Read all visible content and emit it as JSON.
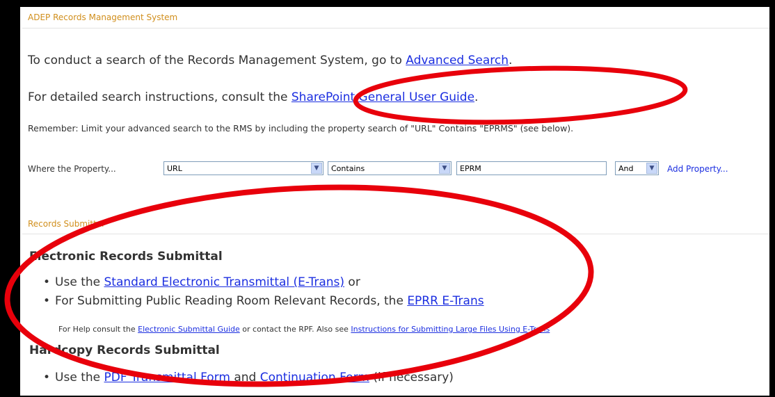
{
  "rms_section": {
    "title": "ADEP Records Management System"
  },
  "intro": {
    "line1_prefix": "To conduct a search of the Records Management System, go to ",
    "line1_link": "Advanced Search",
    "line1_suffix": ".",
    "line2_prefix": "For detailed search instructions, consult the ",
    "line2_link": "SharePoint General User Guide",
    "line2_suffix": ".",
    "reminder": "Remember: Limit your advanced search to the RMS by including the property search of \"URL\" Contains \"EPRMS\" (see below)."
  },
  "property_row": {
    "label": "Where the Property...",
    "property_value": "URL",
    "operator_value": "Contains",
    "text_value": "EPRM",
    "conjunction_value": "And",
    "add_link": "Add Property..."
  },
  "submittal_section": {
    "title": "Records Submittal"
  },
  "electronic": {
    "heading": "Electronic Records Submittal",
    "item1_prefix": "Use the ",
    "item1_link": "Standard Electronic Transmittal (E-Trans)",
    "item1_suffix": " or",
    "item2_prefix": "For Submitting Public Reading Room Relevant Records, the ",
    "item2_link": "EPRR E-Trans",
    "help_prefix": "For Help consult the ",
    "help_link1": "Electronic Submittal Guide",
    "help_middle": " or contact the RPF. Also see ",
    "help_link2": "Instructions for Submitting Large Files Using E-Trans"
  },
  "hardcopy": {
    "heading": "Hardcopy Records Submittal",
    "item1_prefix": "Use the ",
    "item1_link1": "PDF Transmittal Form",
    "item1_middle": " and ",
    "item1_link2": "Continuation Form",
    "item1_suffix": " (if necessary)"
  },
  "bullet_glyph": "•",
  "colors": {
    "section_title": "#d18f1d",
    "link": "#1b2ee0",
    "annotation": "#e8000b",
    "frame": "#000000"
  }
}
